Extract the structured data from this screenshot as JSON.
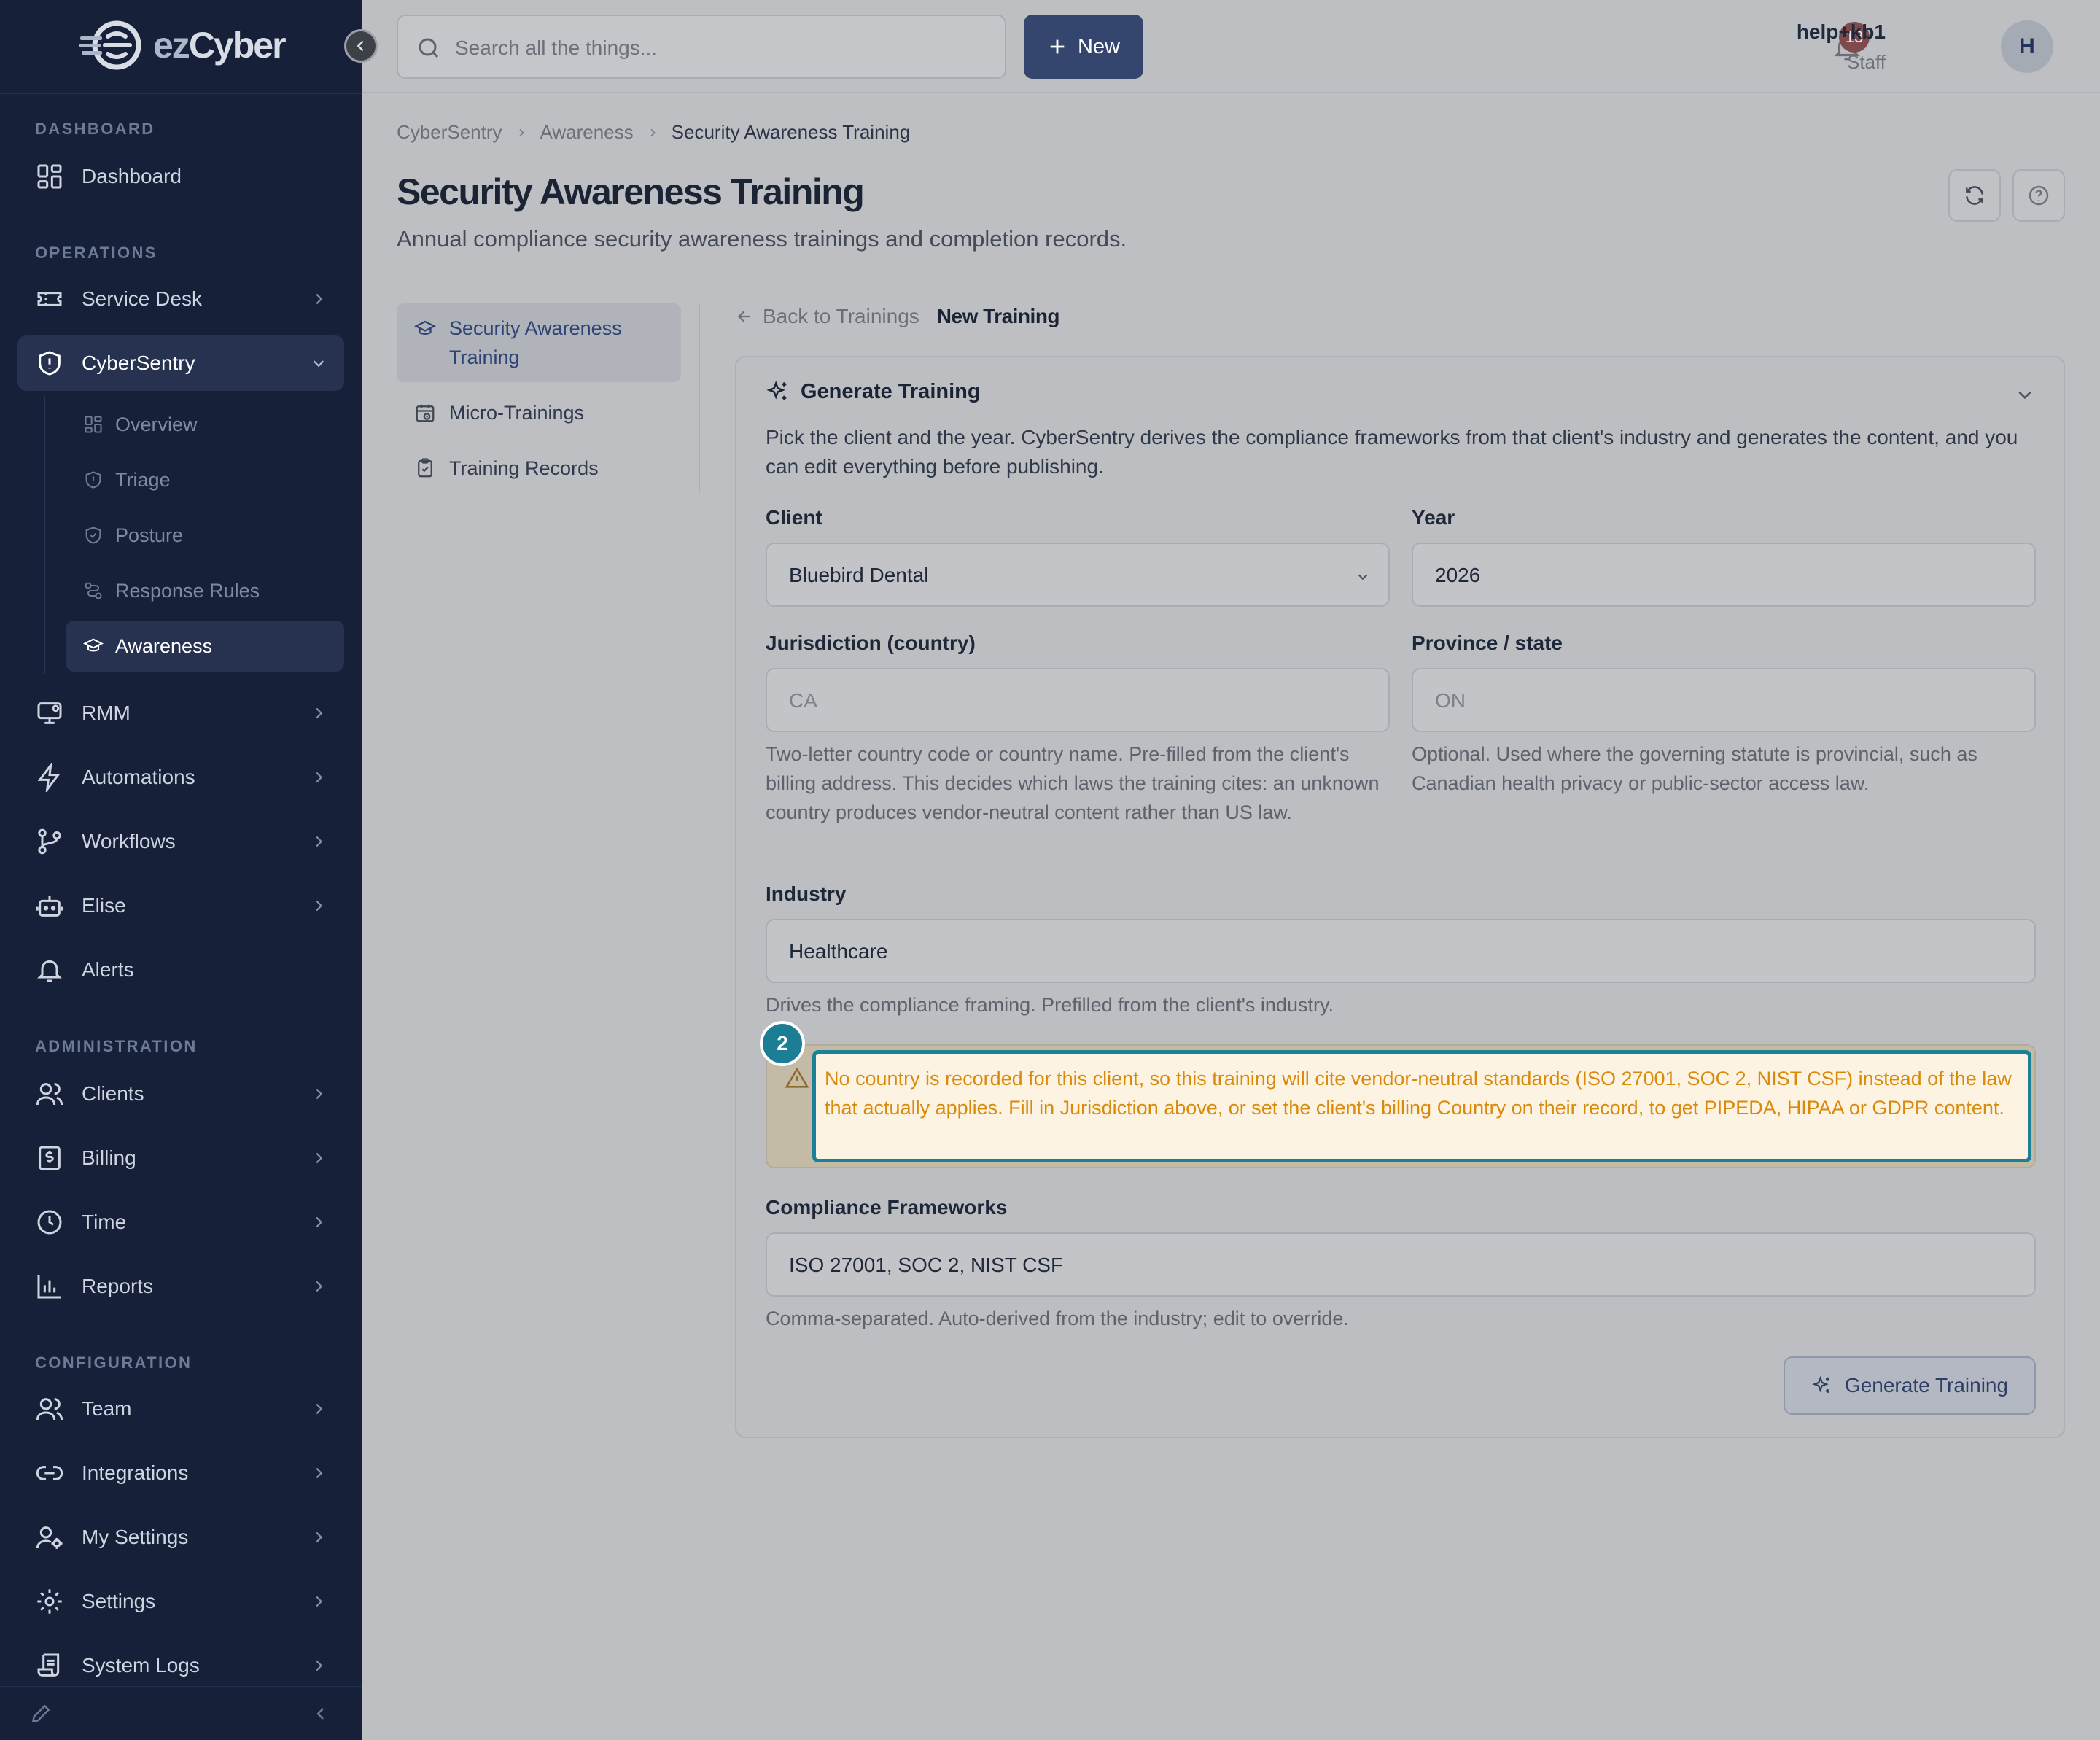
{
  "brand": {
    "logo_ez": "ez",
    "logo_cyber": "Cyber"
  },
  "topbar": {
    "search_placeholder": "Search all the things...",
    "new_label": "New",
    "notification_count": "13",
    "user_name": "help+kb1",
    "user_role": "Staff",
    "avatar_initial": "H"
  },
  "sidebar": {
    "sections": {
      "dashboard": "DASHBOARD",
      "operations": "OPERATIONS",
      "administration": "ADMINISTRATION",
      "configuration": "CONFIGURATION"
    },
    "items": {
      "dashboard": "Dashboard",
      "service_desk": "Service Desk",
      "cybersentry": "CyberSentry",
      "rmm": "RMM",
      "automations": "Automations",
      "workflows": "Workflows",
      "elise": "Elise",
      "alerts": "Alerts",
      "clients": "Clients",
      "billing": "Billing",
      "time": "Time",
      "reports": "Reports",
      "team": "Team",
      "integrations": "Integrations",
      "my_settings": "My Settings",
      "settings": "Settings",
      "system_logs": "System Logs"
    },
    "cybersentry_sub": {
      "overview": "Overview",
      "triage": "Triage",
      "posture": "Posture",
      "response_rules": "Response Rules",
      "awareness": "Awareness"
    }
  },
  "breadcrumb": [
    "CyberSentry",
    "Awareness",
    "Security Awareness Training"
  ],
  "page": {
    "title": "Security Awareness Training",
    "subtitle": "Annual compliance security awareness trainings and completion records."
  },
  "subnav": {
    "security_awareness": "Security Awareness Training",
    "micro_trainings": "Micro-Trainings",
    "training_records": "Training Records"
  },
  "content": {
    "back_label": "Back to Trainings",
    "current_label": "New Training"
  },
  "card": {
    "title": "Generate Training",
    "description": "Pick the client and the year. CyberSentry derives the compliance frameworks from that client's industry and generates the content, and you can edit everything before publishing.",
    "client": {
      "label": "Client",
      "value": "Bluebird Dental"
    },
    "year": {
      "label": "Year",
      "value": "2026"
    },
    "jurisdiction": {
      "label": "Jurisdiction (country)",
      "placeholder": "CA",
      "help": "Two-letter country code or country name. Pre-filled from the client's billing address. This decides which laws the training cites: an unknown country produces vendor-neutral content rather than US law."
    },
    "province": {
      "label": "Province / state",
      "placeholder": "ON",
      "help": "Optional. Used where the governing statute is provincial, such as Canadian health privacy or public-sector access law."
    },
    "industry": {
      "label": "Industry",
      "value": "Healthcare",
      "help": "Drives the compliance framing. Prefilled from the client's industry."
    },
    "warning": "No country is recorded for this client, so this training will cite vendor-neutral standards (ISO 27001, SOC 2, NIST CSF) instead of the law that actually applies. Fill in Jurisdiction above, or set the client's billing Country on their record, to get PIPEDA, HIPAA or GDPR content.",
    "step_badge": "2",
    "frameworks": {
      "label": "Compliance Frameworks",
      "value": "ISO 27001, SOC 2, NIST CSF",
      "help": "Comma-separated. Auto-derived from the industry; edit to override."
    },
    "generate_button": "Generate Training"
  }
}
